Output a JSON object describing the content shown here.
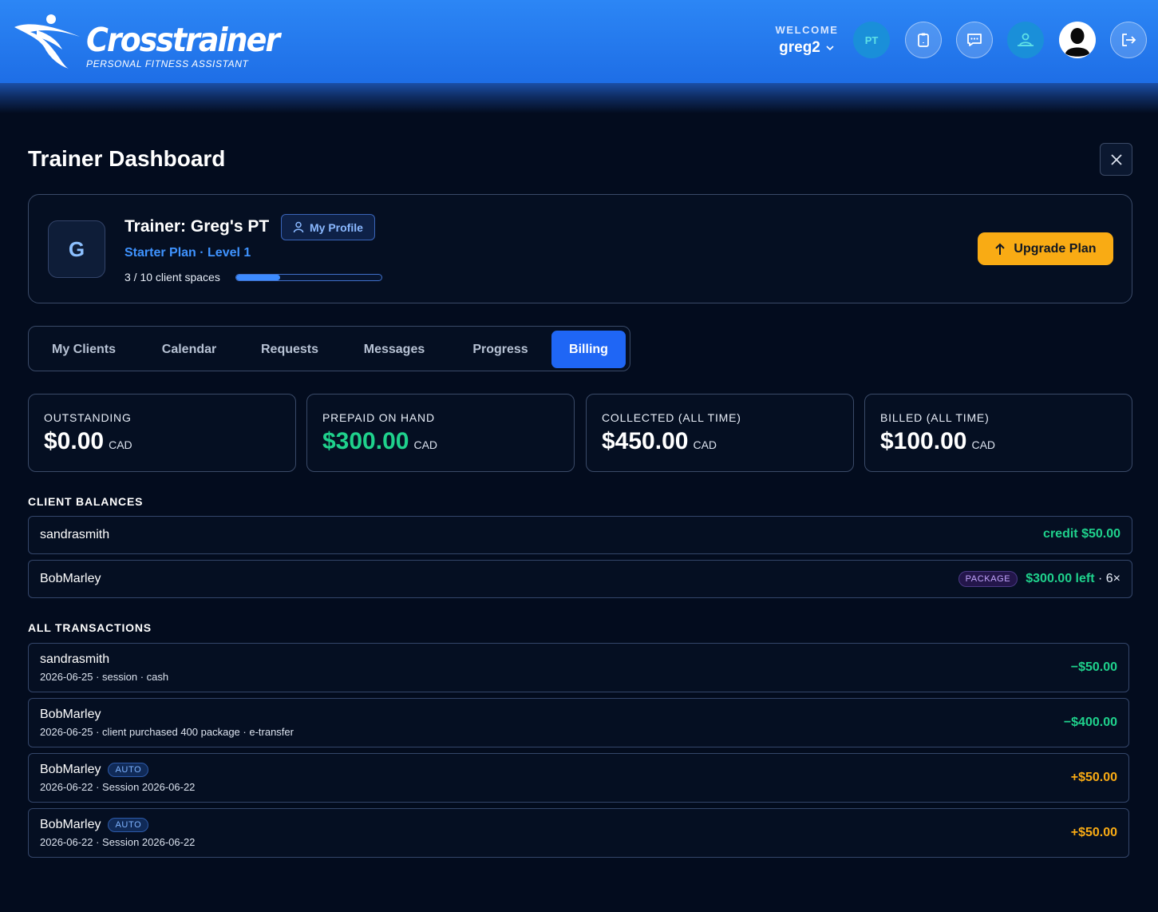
{
  "header": {
    "brand": "Crosstrainer",
    "tagline": "PERSONAL FITNESS ASSISTANT",
    "welcome_label": "WELCOME",
    "username": "greg2",
    "pt_badge": "PT",
    "icons": [
      "clipboard-icon",
      "chat-icon",
      "clients-icon",
      "avatar",
      "logout-icon"
    ]
  },
  "page": {
    "title": "Trainer Dashboard"
  },
  "profile": {
    "initial": "G",
    "name_prefix": "Trainer:",
    "name": "Greg's PT",
    "my_profile_label": "My Profile",
    "plan": "Starter Plan · Level 1",
    "spaces_text": "3 / 10 client spaces",
    "spaces_used_fraction": 0.3,
    "upgrade_label": "Upgrade Plan"
  },
  "tabs": [
    {
      "label": "My Clients",
      "active": false
    },
    {
      "label": "Calendar",
      "active": false
    },
    {
      "label": "Requests",
      "active": false
    },
    {
      "label": "Messages",
      "active": false
    },
    {
      "label": "Progress",
      "active": false
    },
    {
      "label": "Billing",
      "active": true
    }
  ],
  "stats": [
    {
      "label": "OUTSTANDING",
      "value": "$0.00",
      "unit": "CAD"
    },
    {
      "label": "PREPAID ON HAND",
      "value": "$300.00",
      "unit": "CAD"
    },
    {
      "label": "COLLECTED (ALL TIME)",
      "value": "$450.00",
      "unit": "CAD"
    },
    {
      "label": "BILLED (ALL TIME)",
      "value": "$100.00",
      "unit": "CAD"
    }
  ],
  "client_balances": {
    "heading": "CLIENT BALANCES",
    "rows": [
      {
        "name": "sandrasmith",
        "credit": "credit $50.00"
      },
      {
        "name": "BobMarley",
        "badge": "PACKAGE",
        "left": "$300.00 left",
        "mult": "· 6×"
      }
    ]
  },
  "transactions": {
    "heading": "ALL TRANSACTIONS",
    "rows": [
      {
        "name": "sandrasmith",
        "badge": "",
        "meta": "2026-06-25 · session · cash",
        "amount": "−$50.00"
      },
      {
        "name": "BobMarley",
        "badge": "",
        "meta": "2026-06-25 · client purchased 400 package · e-transfer",
        "amount": "−$400.00"
      },
      {
        "name": "BobMarley",
        "badge": "AUTO",
        "meta": "2026-06-22 · Session 2026-06-22",
        "amount": "+$50.00"
      },
      {
        "name": "BobMarley",
        "badge": "AUTO",
        "meta": "2026-06-22 · Session 2026-06-22",
        "amount": "+$50.00"
      }
    ]
  },
  "colors": {
    "accent": "#1f66f5",
    "upgrade": "#f9ab14",
    "positive": "#1fd18c",
    "charge": "#f9ab14",
    "background": "#030c1e"
  }
}
